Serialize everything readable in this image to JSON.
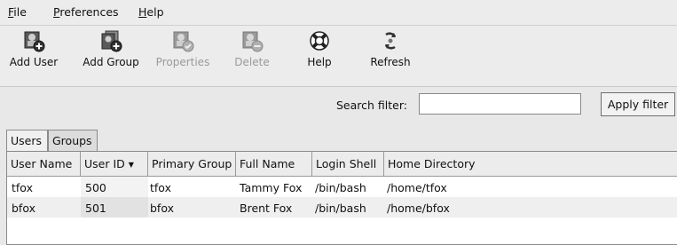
{
  "menubar": {
    "items": [
      {
        "underline": "F",
        "rest": "ile"
      },
      {
        "underline": "P",
        "rest": "references"
      },
      {
        "underline": "H",
        "rest": "elp"
      }
    ]
  },
  "toolbar": {
    "add_user": "Add User",
    "add_group": "Add Group",
    "properties": "Properties",
    "delete": "Delete",
    "help": "Help",
    "refresh": "Refresh"
  },
  "search": {
    "label": "Search filter:",
    "value": "",
    "placeholder": "",
    "apply_label": "Apply filter"
  },
  "tabs": {
    "users": "Users",
    "groups": "Groups",
    "active": "Users"
  },
  "table": {
    "columns": [
      "User Name",
      "User ID",
      "Primary Group",
      "Full Name",
      "Login Shell",
      "Home Directory"
    ],
    "sort_column": "User ID",
    "rows": [
      [
        "tfox",
        "500",
        "tfox",
        "Tammy Fox",
        "/bin/bash",
        "/home/tfox"
      ],
      [
        "bfox",
        "501",
        "bfox",
        "Brent Fox",
        "/bin/bash",
        "/home/bfox"
      ]
    ]
  },
  "colors": {
    "background": "#e8e8e8",
    "list_background": "#ffffff",
    "disabled_text": "#9a9a9a"
  }
}
